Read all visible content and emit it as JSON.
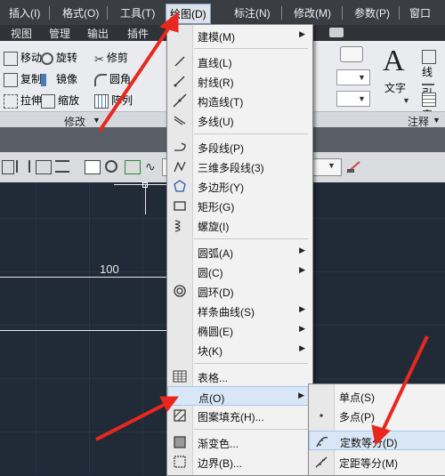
{
  "menubar": {
    "items": [
      "插入(I)",
      "格式(O)",
      "工具(T)",
      "绘图(D)",
      "标注(N)",
      "修改(M)",
      "参数(P)",
      "窗口"
    ]
  },
  "ribbon_tabs": [
    "视图",
    "管理",
    "输出",
    "插件"
  ],
  "ribbon": {
    "modify_tools": [
      "移动",
      "旋转",
      "修剪",
      "复制",
      "镜像",
      "圆角",
      "拉伸",
      "缩放",
      "阵列"
    ],
    "text_label": "文字",
    "text_right_items": [
      "线",
      "引",
      "表"
    ],
    "panel_modify": "修改",
    "panel_annot": "注释"
  },
  "canvas": {
    "dim_value": "100"
  },
  "draw_menu": {
    "items": [
      {
        "label": "建模(M)",
        "icon": "modeling-icon",
        "submenu": true
      },
      {
        "label": "直线(L)",
        "icon": "line-icon",
        "submenu": false
      },
      {
        "label": "射线(R)",
        "icon": "ray-icon",
        "submenu": false
      },
      {
        "label": "构造线(T)",
        "icon": "xline-icon",
        "submenu": false
      },
      {
        "label": "多线(U)",
        "icon": "mline-icon",
        "submenu": false
      },
      {
        "label": "多段线(P)",
        "icon": "polyline-icon",
        "submenu": false
      },
      {
        "label": "三维多段线(3)",
        "icon": "3dpoly-icon",
        "submenu": false
      },
      {
        "label": "多边形(Y)",
        "icon": "polygon-icon",
        "submenu": false
      },
      {
        "label": "矩形(G)",
        "icon": "rectangle-icon",
        "submenu": false
      },
      {
        "label": "螺旋(I)",
        "icon": "helix-icon",
        "submenu": false
      },
      {
        "label": "圆弧(A)",
        "icon": "arc-icon",
        "submenu": true
      },
      {
        "label": "圆(C)",
        "icon": "circle-icon",
        "submenu": true
      },
      {
        "label": "圆环(D)",
        "icon": "donut-icon",
        "submenu": false
      },
      {
        "label": "样条曲线(S)",
        "icon": "spline-icon",
        "submenu": true
      },
      {
        "label": "椭圆(E)",
        "icon": "ellipse-icon",
        "submenu": true
      },
      {
        "label": "块(K)",
        "icon": "block-icon",
        "submenu": true
      },
      {
        "label": "表格...",
        "icon": "table-icon",
        "submenu": false
      },
      {
        "label": "点(O)",
        "icon": "point-icon",
        "submenu": true
      },
      {
        "label": "图案填充(H)...",
        "icon": "hatch-icon",
        "submenu": false
      },
      {
        "label": "渐变色...",
        "icon": "gradient-icon",
        "submenu": false
      },
      {
        "label": "边界(B)...",
        "icon": "boundary-icon",
        "submenu": false
      }
    ]
  },
  "point_submenu": {
    "items": [
      "单点(S)",
      "多点(P)",
      "定数等分(D)",
      "定距等分(M)"
    ]
  },
  "colors": {
    "annotation_arrow": "#e8281e",
    "menu_highlight": "#d9e6f6"
  }
}
